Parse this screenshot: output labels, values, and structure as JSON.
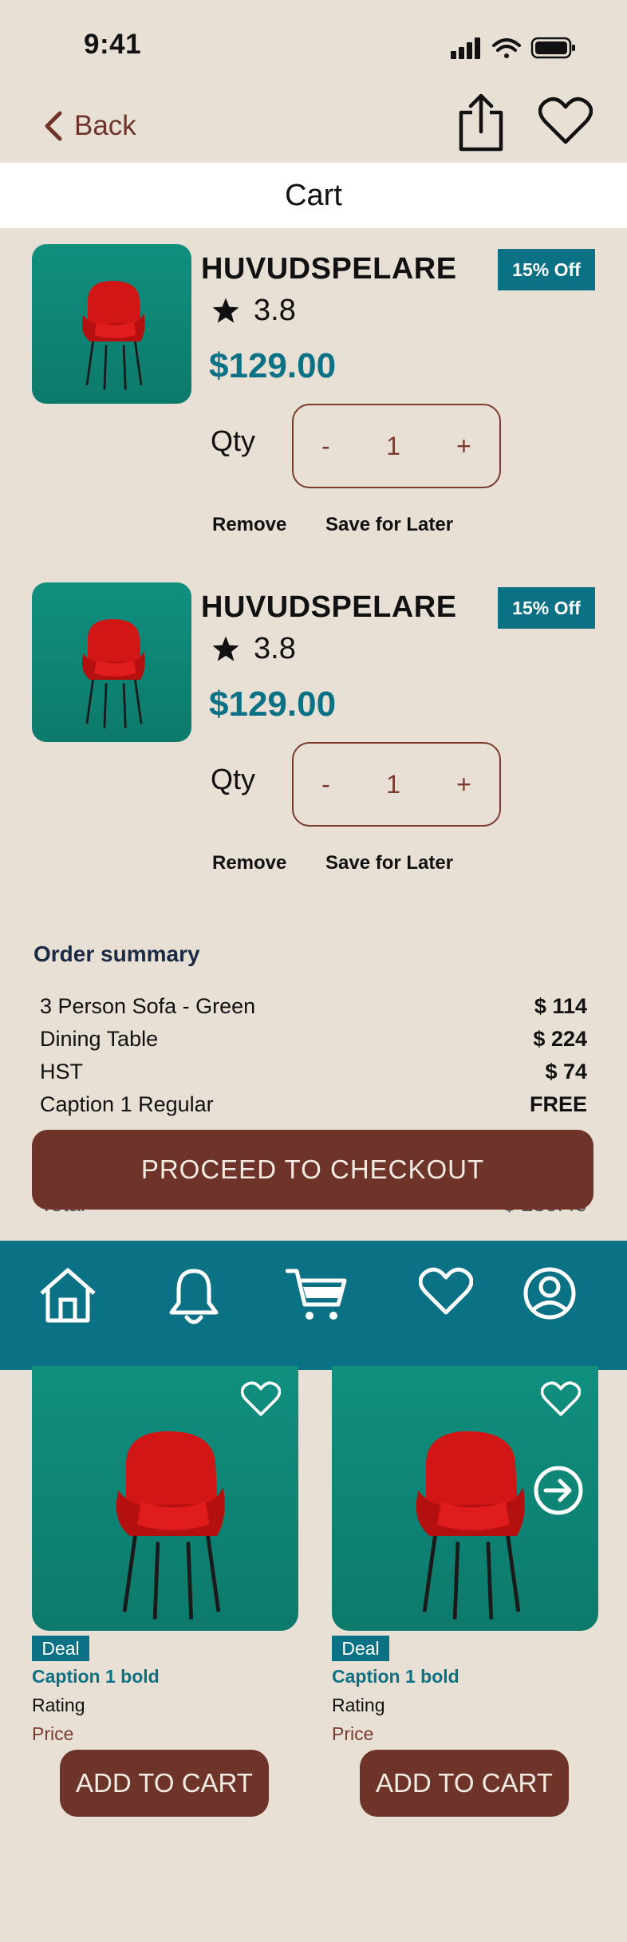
{
  "status": {
    "time": "9:41"
  },
  "nav": {
    "back_label": "Back"
  },
  "header": {
    "title": "Cart"
  },
  "cart_items": [
    {
      "name": "HUVUDSPELARE",
      "discount": "15% Off",
      "rating": "3.8",
      "price": "$129.00",
      "qty_label": "Qty",
      "qty_minus": "-",
      "qty_value": "1",
      "qty_plus": "+",
      "remove_label": "Remove",
      "save_label": "Save for Later"
    },
    {
      "name": "HUVUDSPELARE",
      "discount": "15% Off",
      "rating": "3.8",
      "price": "$129.00",
      "qty_label": "Qty",
      "qty_minus": "-",
      "qty_value": "1",
      "qty_plus": "+",
      "remove_label": "Remove",
      "save_label": "Save for Later"
    }
  ],
  "order_summary": {
    "title": "Order summary",
    "rows": [
      {
        "label": "3 Person Sofa - Green",
        "value": "$ 114"
      },
      {
        "label": "Dining Table",
        "value": "$ 224"
      },
      {
        "label": "HST",
        "value": "$ 74"
      },
      {
        "label": "Caption 1 Regular",
        "value": "FREE"
      }
    ],
    "total_label": "Total",
    "total_value": "$ 230.40"
  },
  "checkout": {
    "label": "PROCEED TO CHECKOUT"
  },
  "tabbar": {
    "icons": [
      "home-icon",
      "bell-icon",
      "cart-icon",
      "heart-icon",
      "user-icon"
    ]
  },
  "products": [
    {
      "deal": "Deal",
      "caption": "Caption 1 bold",
      "rating": "Rating",
      "price": "Price",
      "button": "ADD TO CART"
    },
    {
      "deal": "Deal",
      "caption": "Caption 1 bold",
      "rating": "Rating",
      "price": "Price",
      "button": "ADD TO CART"
    }
  ],
  "colors": {
    "accent": "#0b7185",
    "brand": "#6e3429",
    "background": "#e8e0d5"
  }
}
